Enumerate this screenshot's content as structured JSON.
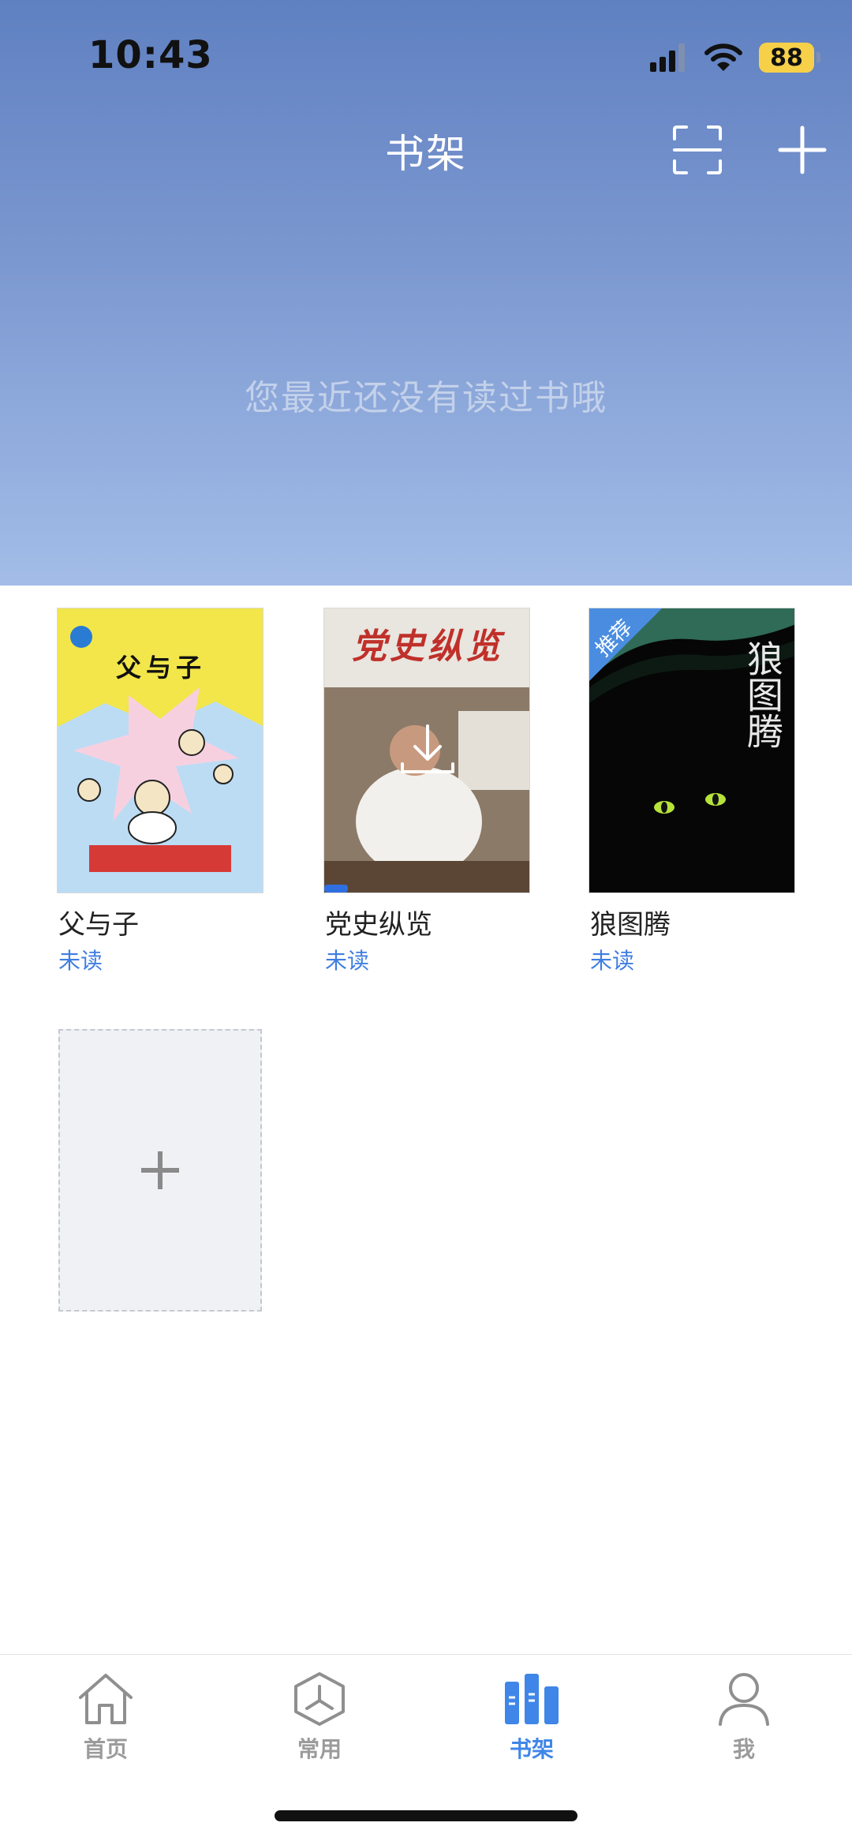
{
  "status_bar": {
    "time": "10:43",
    "battery": "88"
  },
  "header": {
    "title": "书架",
    "empty_message": "您最近还没有读过书哦"
  },
  "books": [
    {
      "title": "父与子",
      "status": "未读",
      "cover": {
        "heading": "父与子"
      }
    },
    {
      "title": "党史纵览",
      "status": "未读",
      "cover": {
        "heading": "党史纵览"
      }
    },
    {
      "title": "狼图腾",
      "status": "未读",
      "badge": "推荐",
      "cover": {
        "heading": "狼图腾"
      }
    }
  ],
  "tabs": [
    {
      "label": "首页",
      "icon": "home-icon",
      "active": false
    },
    {
      "label": "常用",
      "icon": "hexagon-icon",
      "active": false
    },
    {
      "label": "书架",
      "icon": "bookshelf-icon",
      "active": true
    },
    {
      "label": "我",
      "icon": "user-icon",
      "active": false
    }
  ],
  "colors": {
    "accent": "#3f86e8",
    "status_unread": "#3f7ee0",
    "header_top": "#5f80c1",
    "header_bottom": "#a3bde8"
  }
}
